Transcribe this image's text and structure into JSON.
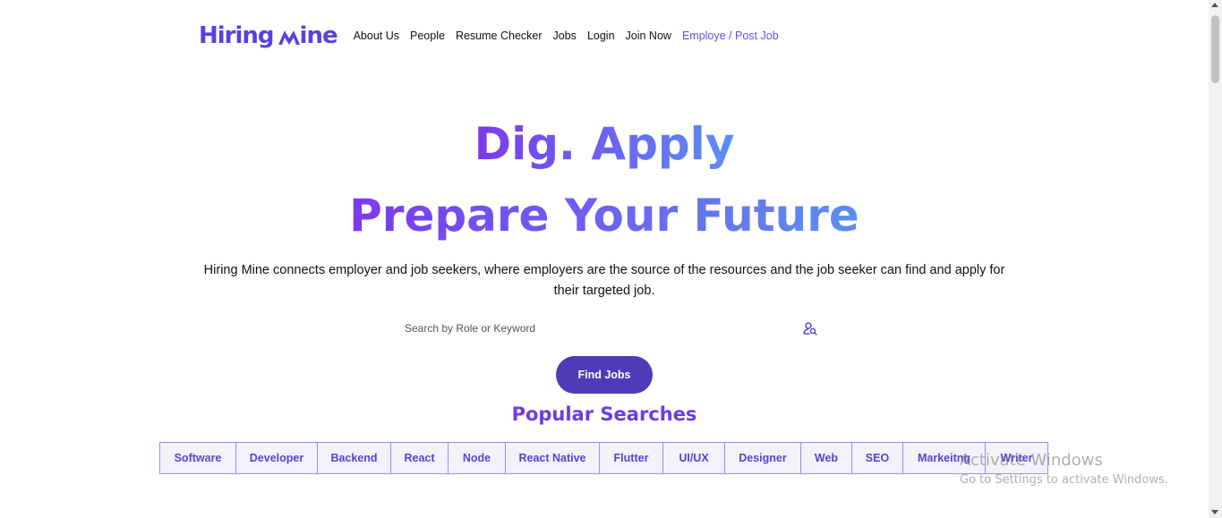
{
  "brand": {
    "name_a": "Hiring",
    "name_b": "ine",
    "mark_letter": "M",
    "color": "#5b3fe0"
  },
  "nav": {
    "links": [
      {
        "label": "About Us"
      },
      {
        "label": "People"
      },
      {
        "label": "Resume Checker"
      },
      {
        "label": "Jobs"
      },
      {
        "label": "Login"
      },
      {
        "label": "Join Now"
      },
      {
        "label": "Employe / Post Job",
        "accent": true
      }
    ]
  },
  "hero": {
    "line1": "Dig. Apply",
    "line2": "Prepare Your Future",
    "description": "Hiring Mine connects employer and job seekers, where employers are the source of the resources and the job seeker can find and apply for their targeted job."
  },
  "search": {
    "placeholder": "Search by Role or Keyword",
    "value": "",
    "icon": "user-search-icon"
  },
  "find_button": {
    "label": "Find Jobs",
    "color": "#4e3bb8"
  },
  "popular": {
    "title": "Popular Searches",
    "tags": [
      "Software",
      "Developer",
      "Backend",
      "React",
      "Node",
      "React Native",
      "Flutter",
      "UI/UX",
      "Designer",
      "Web",
      "SEO",
      "Markeitng",
      "Writer"
    ]
  },
  "watermark": {
    "line1": "Activate Windows",
    "line2": "Go to Settings to activate Windows."
  },
  "colors": {
    "gradient_start": "#7c3aed",
    "gradient_end": "#5b8ff2",
    "accent": "#6d3ae6",
    "tag_bg": "#f3f2fb",
    "tag_border": "#9b8cf0"
  }
}
